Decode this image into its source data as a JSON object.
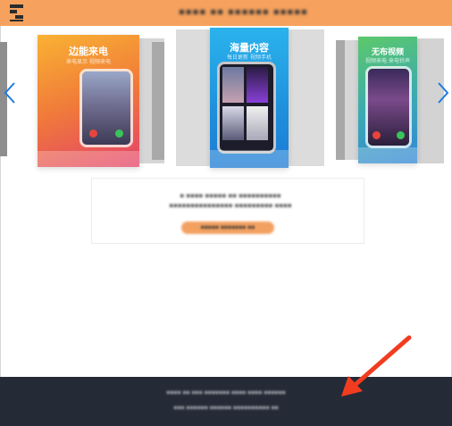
{
  "header": {
    "title": "▪▪▪▪ ▪▪ ▪▪▪▪▪▪ ▪▪▪▪▪"
  },
  "carousel": {
    "cards": [
      {
        "title": "边能来电",
        "subtitle": "来电显示 视频来电"
      },
      {
        "title": "海量内容",
        "subtitle": "每日更新 视频手机"
      },
      {
        "title": "无布视频",
        "subtitle": "视频来电 来电铃声"
      }
    ],
    "prev_icon": "chevron-left-icon",
    "next_icon": "chevron-right-icon"
  },
  "info": {
    "text_line1": "▪ ▪▪▪▪ ▪▪▪▪▪ ▪▪ ▪▪▪▪▪▪▪▪▪▪",
    "text_line2": "▪▪▪▪▪▪▪▪▪▪▪▪▪▪▪ ▪▪▪▪▪▪▪▪▪ ▪▪▪▪",
    "button_label": "▪▪▪▪▪ ▪▪▪▪▪▪▪ ▪▪"
  },
  "footer": {
    "line1": "▪▪▪▪ ▪▪ ▪▪▪ ▪▪▪▪▪▪▪ ▪▪▪▪ ▪▪▪▪ ▪▪▪▪▪▪",
    "line2": "▪▪▪ ▪▪▪▪▪▪ ▪▪▪▪▪▪ ▪▪▪▪▪▪▪▪▪▪ ▪▪"
  },
  "colors": {
    "header_bg": "#f6a25e",
    "footer_bg": "#252b36",
    "accent_arrow": "#f23c20",
    "nav_blue": "#1f7ae0"
  }
}
